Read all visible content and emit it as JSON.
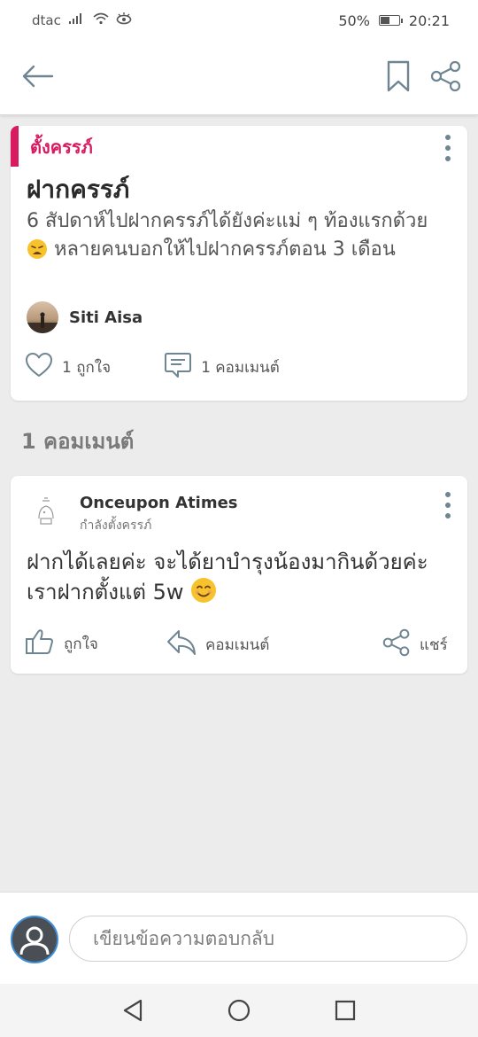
{
  "status_bar": {
    "carrier": "dtac",
    "battery_percent": "50%",
    "time": "20:21",
    "icons": [
      "signal-icon",
      "wifi-icon",
      "eye-comfort-icon",
      "battery-icon"
    ]
  },
  "header": {
    "icons": [
      "back-arrow-icon",
      "bookmark-icon",
      "share-icon"
    ]
  },
  "post": {
    "category": "ตั้งครรภ์",
    "title": "ฝากครรภ์",
    "body_part1": "6 สัปดาห์ไปฝากครรภ์ได้ยังค่ะแม่ ๆ ท้องแรกด้วย",
    "body_emoji": "😩",
    "body_part2": "หลายคนบอกให้ไปฝากครรภ์ตอน 3 เดือน",
    "author": "Siti Aisa",
    "likes_label": "1 ถูกใจ",
    "comments_label": "1 คอมเมนต์"
  },
  "comments_heading": "1 คอมเมนต์",
  "comment": {
    "author": "Onceupon Atimes",
    "subtitle": "กำลังตั้งครรภ์",
    "text": "ฝากได้เลยค่ะ จะได้ยาบำรุงน้องมากินด้วยค่ะ เราฝากตั้งแต่ 5w",
    "emoji": "😊",
    "like_label": "ถูกใจ",
    "reply_label": "คอมเมนต์",
    "share_label": "แชร์"
  },
  "compose": {
    "placeholder": "เขียนข้อความตอบกลับ"
  },
  "colors": {
    "accent": "#d81b60",
    "icon": "#6f8591",
    "background": "#ececec"
  }
}
